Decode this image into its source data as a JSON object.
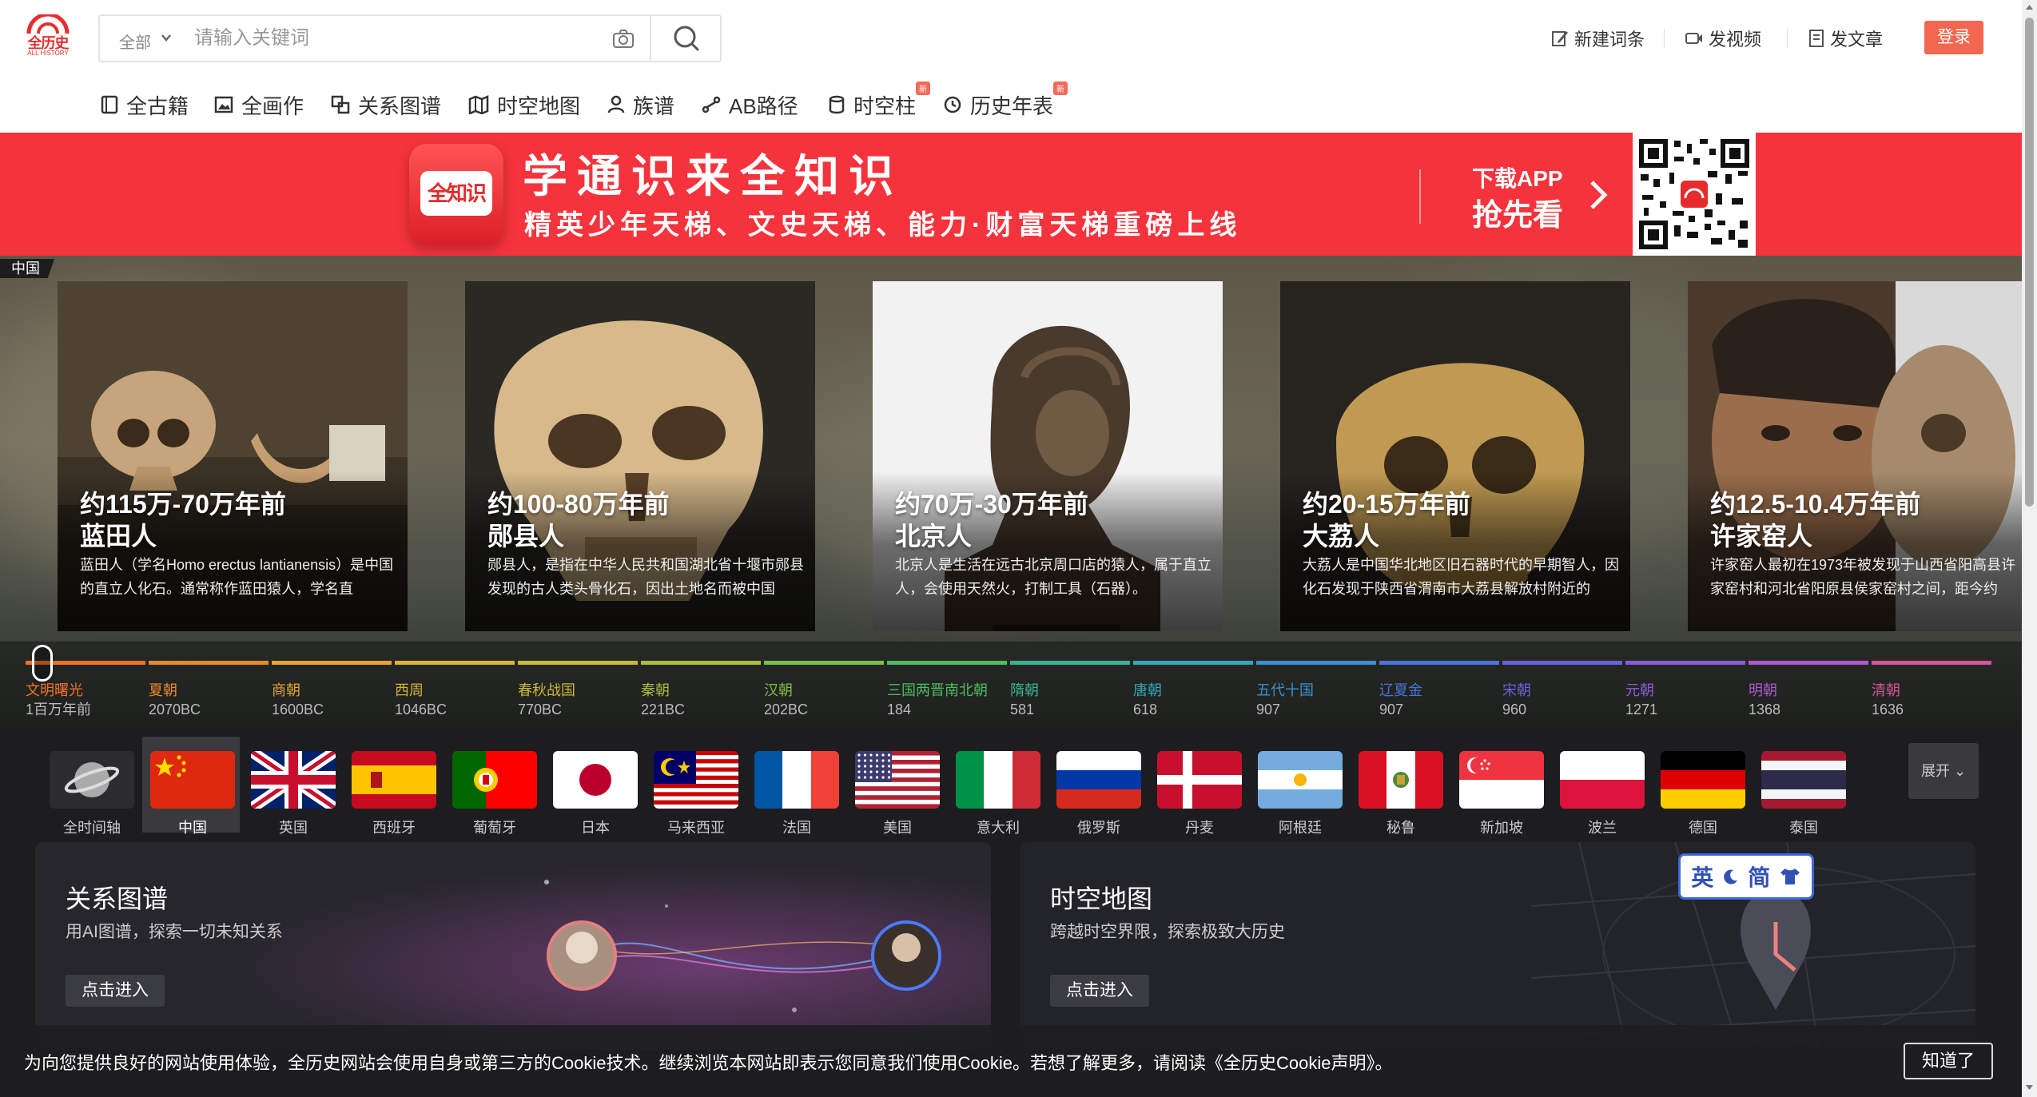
{
  "header": {
    "logo_text": "全历史",
    "logo_sub": "ALL HISTORY",
    "search_scope": "全部",
    "search_placeholder": "请输入关键词",
    "actions": [
      {
        "label": "新建词条",
        "icon": "edit-icon"
      },
      {
        "label": "发视频",
        "icon": "video-icon"
      },
      {
        "label": "发文章",
        "icon": "article-icon"
      }
    ],
    "login_label": "登录"
  },
  "nav": [
    {
      "label": "全古籍",
      "icon": "book-icon"
    },
    {
      "label": "全画作",
      "icon": "painting-icon"
    },
    {
      "label": "关系图谱",
      "icon": "graph-icon"
    },
    {
      "label": "时空地图",
      "icon": "map-icon"
    },
    {
      "label": "族谱",
      "icon": "person-icon"
    },
    {
      "label": "AB路径",
      "icon": "path-icon"
    },
    {
      "label": "时空柱",
      "icon": "database-icon",
      "badge": "新"
    },
    {
      "label": "历史年表",
      "icon": "clock-icon",
      "badge": "新"
    }
  ],
  "banner": {
    "app_name": "全知识",
    "title": "学通识来全知识",
    "subtitle": "精英少年天梯、文史天梯、能力·财富天梯重磅上线",
    "download_line1": "下载APP",
    "download_line2": "抢先看"
  },
  "hero": {
    "region_tag": "中国",
    "cards": [
      {
        "date": "约115万-70万年前",
        "name": "蓝田人",
        "desc": "蓝田人（学名Homo erectus lantianensis）是中国的直立人化石。通常称作蓝田猿人，学名直"
      },
      {
        "date": "约100-80万年前",
        "name": "郧县人",
        "desc": "郧县人，是指在中华人民共和国湖北省十堰市郧县发现的古人类头骨化石，因出土地名而被中国"
      },
      {
        "date": "约70万-30万年前",
        "name": "北京人",
        "desc": "北京人是生活在远古北京周口店的猿人，属于直立人，会使用天然火，打制工具（石器）。"
      },
      {
        "date": "约20-15万年前",
        "name": "大荔人",
        "desc": "大荔人是中国华北地区旧石器时代的早期智人，因化石发现于陕西省渭南市大荔县解放村附近的"
      },
      {
        "date": "约12.5-10.4万年前",
        "name": "许家窑人",
        "desc": "许家窑人最初在1973年被发现于山西省阳高县许家窑村和河北省阳原县侯家窑村之间，距今约"
      }
    ]
  },
  "timeline": [
    {
      "name": "文明曙光",
      "year": "1百万年前",
      "color": "#f2702a"
    },
    {
      "name": "夏朝",
      "year": "2070BC",
      "color": "#e8892c"
    },
    {
      "name": "商朝",
      "year": "1600BC",
      "color": "#e5a431"
    },
    {
      "name": "西周",
      "year": "1046BC",
      "color": "#d8b336"
    },
    {
      "name": "春秋战国",
      "year": "770BC",
      "color": "#c8b83b"
    },
    {
      "name": "秦朝",
      "year": "221BC",
      "color": "#a9bd3f"
    },
    {
      "name": "汉朝",
      "year": "202BC",
      "color": "#7cbf48"
    },
    {
      "name": "三国两晋南北朝",
      "year": "184",
      "color": "#4dbb62"
    },
    {
      "name": "隋朝",
      "year": "581",
      "color": "#3bb393"
    },
    {
      "name": "唐朝",
      "year": "618",
      "color": "#37a6b7"
    },
    {
      "name": "五代十国",
      "year": "907",
      "color": "#3a8fd0"
    },
    {
      "name": "辽夏金",
      "year": "907",
      "color": "#4a74db"
    },
    {
      "name": "宋朝",
      "year": "960",
      "color": "#6a62dc"
    },
    {
      "name": "元朝",
      "year": "1271",
      "color": "#8a5bd8"
    },
    {
      "name": "明朝",
      "year": "1368",
      "color": "#ad58cf"
    },
    {
      "name": "清朝",
      "year": "1636",
      "color": "#d1559a"
    }
  ],
  "countries": [
    {
      "label": "全时间轴",
      "flag": "globe"
    },
    {
      "label": "中国",
      "flag": "cn",
      "active": true
    },
    {
      "label": "英国",
      "flag": "gb"
    },
    {
      "label": "西班牙",
      "flag": "es"
    },
    {
      "label": "葡萄牙",
      "flag": "pt"
    },
    {
      "label": "日本",
      "flag": "jp"
    },
    {
      "label": "马来西亚",
      "flag": "my"
    },
    {
      "label": "法国",
      "flag": "fr"
    },
    {
      "label": "美国",
      "flag": "us"
    },
    {
      "label": "意大利",
      "flag": "it"
    },
    {
      "label": "俄罗斯",
      "flag": "ru"
    },
    {
      "label": "丹麦",
      "flag": "dk"
    },
    {
      "label": "阿根廷",
      "flag": "ar"
    },
    {
      "label": "秘鲁",
      "flag": "pe"
    },
    {
      "label": "新加坡",
      "flag": "sg"
    },
    {
      "label": "波兰",
      "flag": "pl"
    },
    {
      "label": "德国",
      "flag": "de"
    },
    {
      "label": "泰国",
      "flag": "th"
    }
  ],
  "expand_label": "展开",
  "features": [
    {
      "title": "关系图谱",
      "desc": "用AI图谱，探索一切未知关系",
      "button": "点击进入"
    },
    {
      "title": "时空地图",
      "desc": "跨越时空界限，探索极致大历史",
      "button": "点击进入"
    }
  ],
  "lang_switch": {
    "en": "英",
    "zh": "简"
  },
  "cookie": {
    "text": "为向您提供良好的网站使用体验，全历史网站会使用自身或第三方的Cookie技术。继续浏览本网站即表示您同意我们使用Cookie。若想了解更多，请阅读《全历史Cookie声明》。",
    "button": "知道了"
  },
  "colors": {
    "brand_red": "#f4333c",
    "login": "#f3664f",
    "dark_bg": "#1d1d20"
  }
}
